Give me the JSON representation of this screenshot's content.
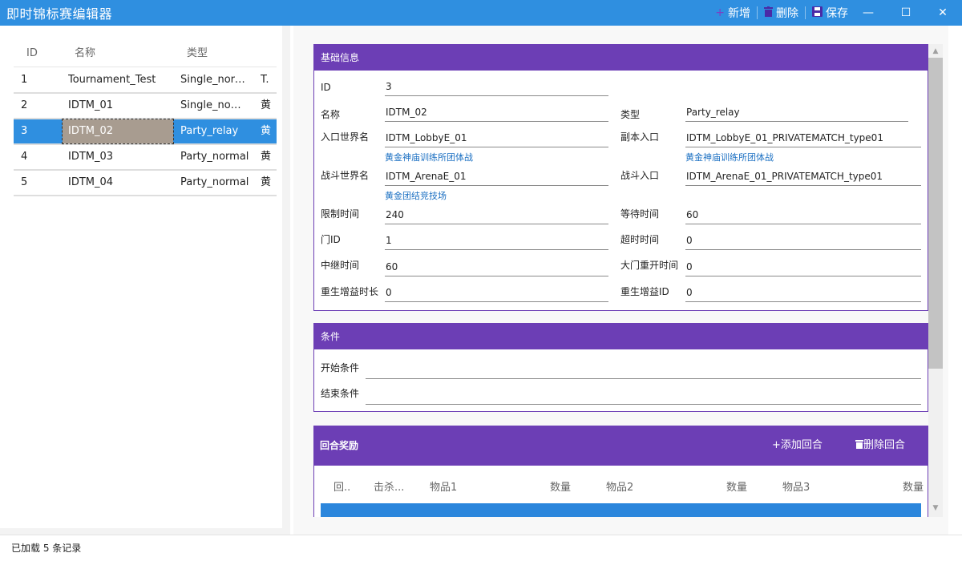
{
  "window": {
    "title": "即时锦标赛编辑器",
    "toolbar": {
      "add_label": "新增",
      "delete_label": "删除",
      "save_label": "保存"
    },
    "controls": {
      "minimize": "—",
      "maximize": "☐",
      "close": "✕"
    }
  },
  "list": {
    "columns": {
      "id": "ID",
      "name": "名称",
      "type": "类型"
    },
    "rows": [
      {
        "id": "1",
        "name": "Tournament_Test",
        "type": "Single_normal",
        "extra": "T."
      },
      {
        "id": "2",
        "name": "IDTM_01",
        "type": "Single_normal",
        "extra": "黄"
      },
      {
        "id": "3",
        "name": "IDTM_02",
        "type": "Party_relay",
        "extra": "黄"
      },
      {
        "id": "4",
        "name": "IDTM_03",
        "type": "Party_normal",
        "extra": "黄"
      },
      {
        "id": "5",
        "name": "IDTM_04",
        "type": "Party_normal",
        "extra": "黄"
      }
    ],
    "selected_id": "3"
  },
  "basic": {
    "title": "基础信息",
    "id_label": "ID",
    "id_value": "3",
    "name_label": "名称",
    "name_value": "IDTM_02",
    "type_label": "类型",
    "type_value": "Party_relay",
    "entry_world_label": "入口世界名",
    "entry_world_value": "IDTM_LobbyE_01",
    "entry_world_hint": "黄金神庙训练所团体战",
    "dungeon_entry_label": "副本入口",
    "dungeon_entry_value": "IDTM_LobbyE_01_PRIVATEMATCH_type01",
    "dungeon_entry_hint": "黄金神庙训练所团体战",
    "battle_world_label": "战斗世界名",
    "battle_world_value": "IDTM_ArenaE_01",
    "battle_world_hint": "黄金团结竞技场",
    "battle_entry_label": "战斗入口",
    "battle_entry_value": "IDTM_ArenaE_01_PRIVATEMATCH_type01",
    "time_limit_label": "限制时间",
    "time_limit_value": "240",
    "wait_time_label": "等待时间",
    "wait_time_value": "60",
    "gate_id_label": "门ID",
    "gate_id_value": "1",
    "timeout_label": "超时时间",
    "timeout_value": "0",
    "relay_time_label": "中继时间",
    "relay_time_value": "60",
    "gate_reopen_label": "大门重开时间",
    "gate_reopen_value": "0",
    "respawn_buff_dur_label": "重生增益时长",
    "respawn_buff_dur_value": "0",
    "respawn_buff_id_label": "重生增益ID",
    "respawn_buff_id_value": "0"
  },
  "conditions": {
    "title": "条件",
    "start_label": "开始条件",
    "start_value": "",
    "end_label": "结束条件",
    "end_value": ""
  },
  "rewards": {
    "title": "回合奖励",
    "add_label": "添加回合",
    "delete_label": "删除回合",
    "columns": [
      "回..",
      "击杀...",
      "物品1",
      "数量",
      "物品2",
      "数量",
      "物品3",
      "数量"
    ]
  },
  "status": {
    "text": "已加载 5 条记录"
  }
}
